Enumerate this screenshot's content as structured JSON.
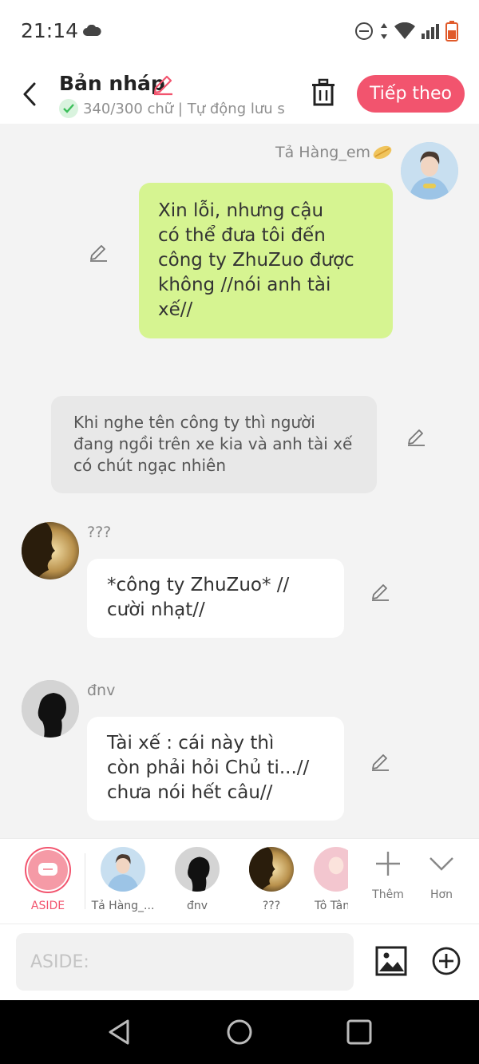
{
  "status_bar": {
    "time": "21:14"
  },
  "header": {
    "title": "Bản nháp",
    "subtitle": "340/300 chữ | Tự động lưu s",
    "next_label": "Tiếp theo"
  },
  "messages": [
    {
      "sender": "Tả Hàng_em",
      "text": "Xin lỗi, nhưng cậu\ncó thể đưa tôi đến\ncông ty ZhuZuo được\nkhông //nói anh tài\nxế//"
    },
    {
      "sender": "",
      "text": "Khi nghe tên công ty thì người\nđang ngồi trên xe kia và anh tài xế\ncó chút ngạc nhiên"
    },
    {
      "sender": "???",
      "text": "*công ty ZhuZuo* //\ncười nhạt//"
    },
    {
      "sender": "đnv",
      "text": "Tài xế : cái này thì\ncòn phải hỏi Chủ ti...//\nchưa nói hết câu//"
    }
  ],
  "characters": [
    {
      "label": "ASIDE"
    },
    {
      "label": "Tả Hàng_..."
    },
    {
      "label": "đnv"
    },
    {
      "label": "???"
    },
    {
      "label": "Tô Tân"
    }
  ],
  "tools": {
    "more_label": "Thêm",
    "expand_label": "Hơn"
  },
  "input": {
    "placeholder": "ASIDE:",
    "value": ""
  },
  "colors": {
    "accent": "#f2546e",
    "own_bubble": "#d6f491",
    "narration_bubble": "#e8e8e8"
  }
}
